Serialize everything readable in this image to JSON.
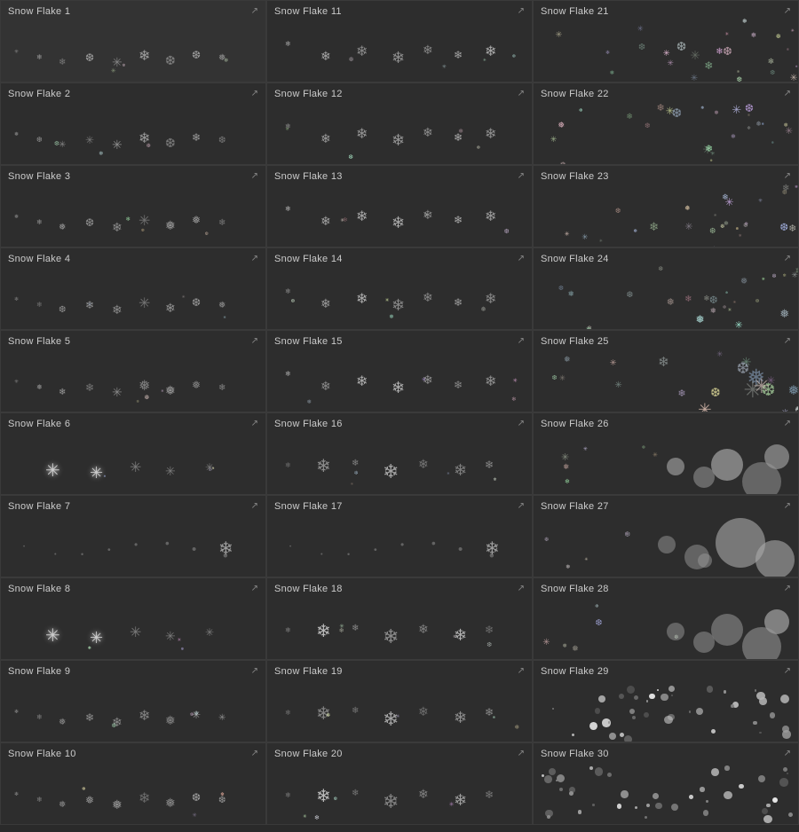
{
  "grid": {
    "columns": 3,
    "rows": 10,
    "cells": [
      {
        "id": 1,
        "label": "Snow Flake 1",
        "type": "scattered_small",
        "col": 0,
        "row": 0
      },
      {
        "id": 11,
        "label": "Snow Flake 11",
        "type": "scattered_medium",
        "col": 1,
        "row": 0
      },
      {
        "id": 21,
        "label": "Snow Flake 21",
        "type": "dense_right",
        "col": 2,
        "row": 0
      },
      {
        "id": 2,
        "label": "Snow Flake 2",
        "type": "scattered_small",
        "col": 0,
        "row": 1
      },
      {
        "id": 12,
        "label": "Snow Flake 12",
        "type": "scattered_medium",
        "col": 1,
        "row": 1
      },
      {
        "id": 22,
        "label": "Snow Flake 22",
        "type": "dense_right",
        "col": 2,
        "row": 1
      },
      {
        "id": 3,
        "label": "Snow Flake 3",
        "type": "scattered_small",
        "col": 0,
        "row": 2
      },
      {
        "id": 13,
        "label": "Snow Flake 13",
        "type": "scattered_medium",
        "col": 1,
        "row": 2
      },
      {
        "id": 23,
        "label": "Snow Flake 23",
        "type": "dense_right",
        "col": 2,
        "row": 2
      },
      {
        "id": 4,
        "label": "Snow Flake 4",
        "type": "scattered_small",
        "col": 0,
        "row": 3
      },
      {
        "id": 14,
        "label": "Snow Flake 14",
        "type": "scattered_medium",
        "col": 1,
        "row": 3
      },
      {
        "id": 24,
        "label": "Snow Flake 24",
        "type": "dense_right",
        "col": 2,
        "row": 3
      },
      {
        "id": 5,
        "label": "Snow Flake 5",
        "type": "scattered_small",
        "col": 0,
        "row": 4
      },
      {
        "id": 15,
        "label": "Snow Flake 15",
        "type": "scattered_medium",
        "col": 1,
        "row": 4
      },
      {
        "id": 25,
        "label": "Snow Flake 25",
        "type": "dense_right_large",
        "col": 2,
        "row": 4
      },
      {
        "id": 6,
        "label": "Snow Flake 6",
        "type": "glowing",
        "col": 0,
        "row": 5
      },
      {
        "id": 16,
        "label": "Snow Flake 16",
        "type": "mixed_size",
        "col": 1,
        "row": 5
      },
      {
        "id": 26,
        "label": "Snow Flake 26",
        "type": "blob_large",
        "col": 2,
        "row": 5
      },
      {
        "id": 7,
        "label": "Snow Flake 7",
        "type": "dot_line",
        "col": 0,
        "row": 6
      },
      {
        "id": 17,
        "label": "Snow Flake 17",
        "type": "dot_line",
        "col": 1,
        "row": 6
      },
      {
        "id": 27,
        "label": "Snow Flake 27",
        "type": "blob_huge",
        "col": 2,
        "row": 6
      },
      {
        "id": 8,
        "label": "Snow Flake 8",
        "type": "glowing",
        "col": 0,
        "row": 7
      },
      {
        "id": 18,
        "label": "Snow Flake 18",
        "type": "mixed_size",
        "col": 1,
        "row": 7
      },
      {
        "id": 28,
        "label": "Snow Flake 28",
        "type": "blob_large",
        "col": 2,
        "row": 7
      },
      {
        "id": 9,
        "label": "Snow Flake 9",
        "type": "scattered_small",
        "col": 0,
        "row": 8
      },
      {
        "id": 19,
        "label": "Snow Flake 19",
        "type": "mixed_size",
        "col": 1,
        "row": 8
      },
      {
        "id": 29,
        "label": "Snow Flake 29",
        "type": "dots_dense",
        "col": 2,
        "row": 8
      },
      {
        "id": 10,
        "label": "Snow Flake 10",
        "type": "scattered_small",
        "col": 0,
        "row": 9
      },
      {
        "id": 20,
        "label": "Snow Flake 20",
        "type": "mixed_size",
        "col": 1,
        "row": 9
      },
      {
        "id": 30,
        "label": "Snow Flake 30",
        "type": "dots_dense",
        "col": 2,
        "row": 9
      }
    ]
  }
}
